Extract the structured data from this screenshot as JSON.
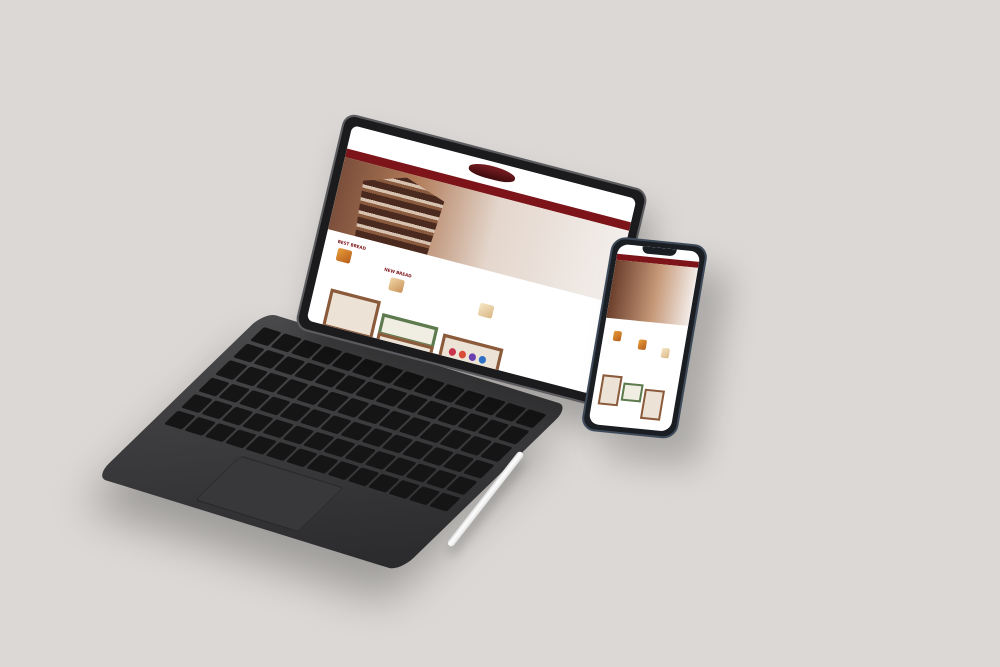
{
  "scene": {
    "background_color": "#dbd8d5",
    "accent_color": "#7c1419"
  },
  "tablet_site": {
    "nav_items": [
      "",
      "",
      "",
      "",
      ""
    ],
    "best_label": "BEST BREAD",
    "new_label": "NEW BREAD"
  },
  "phone_site": {}
}
